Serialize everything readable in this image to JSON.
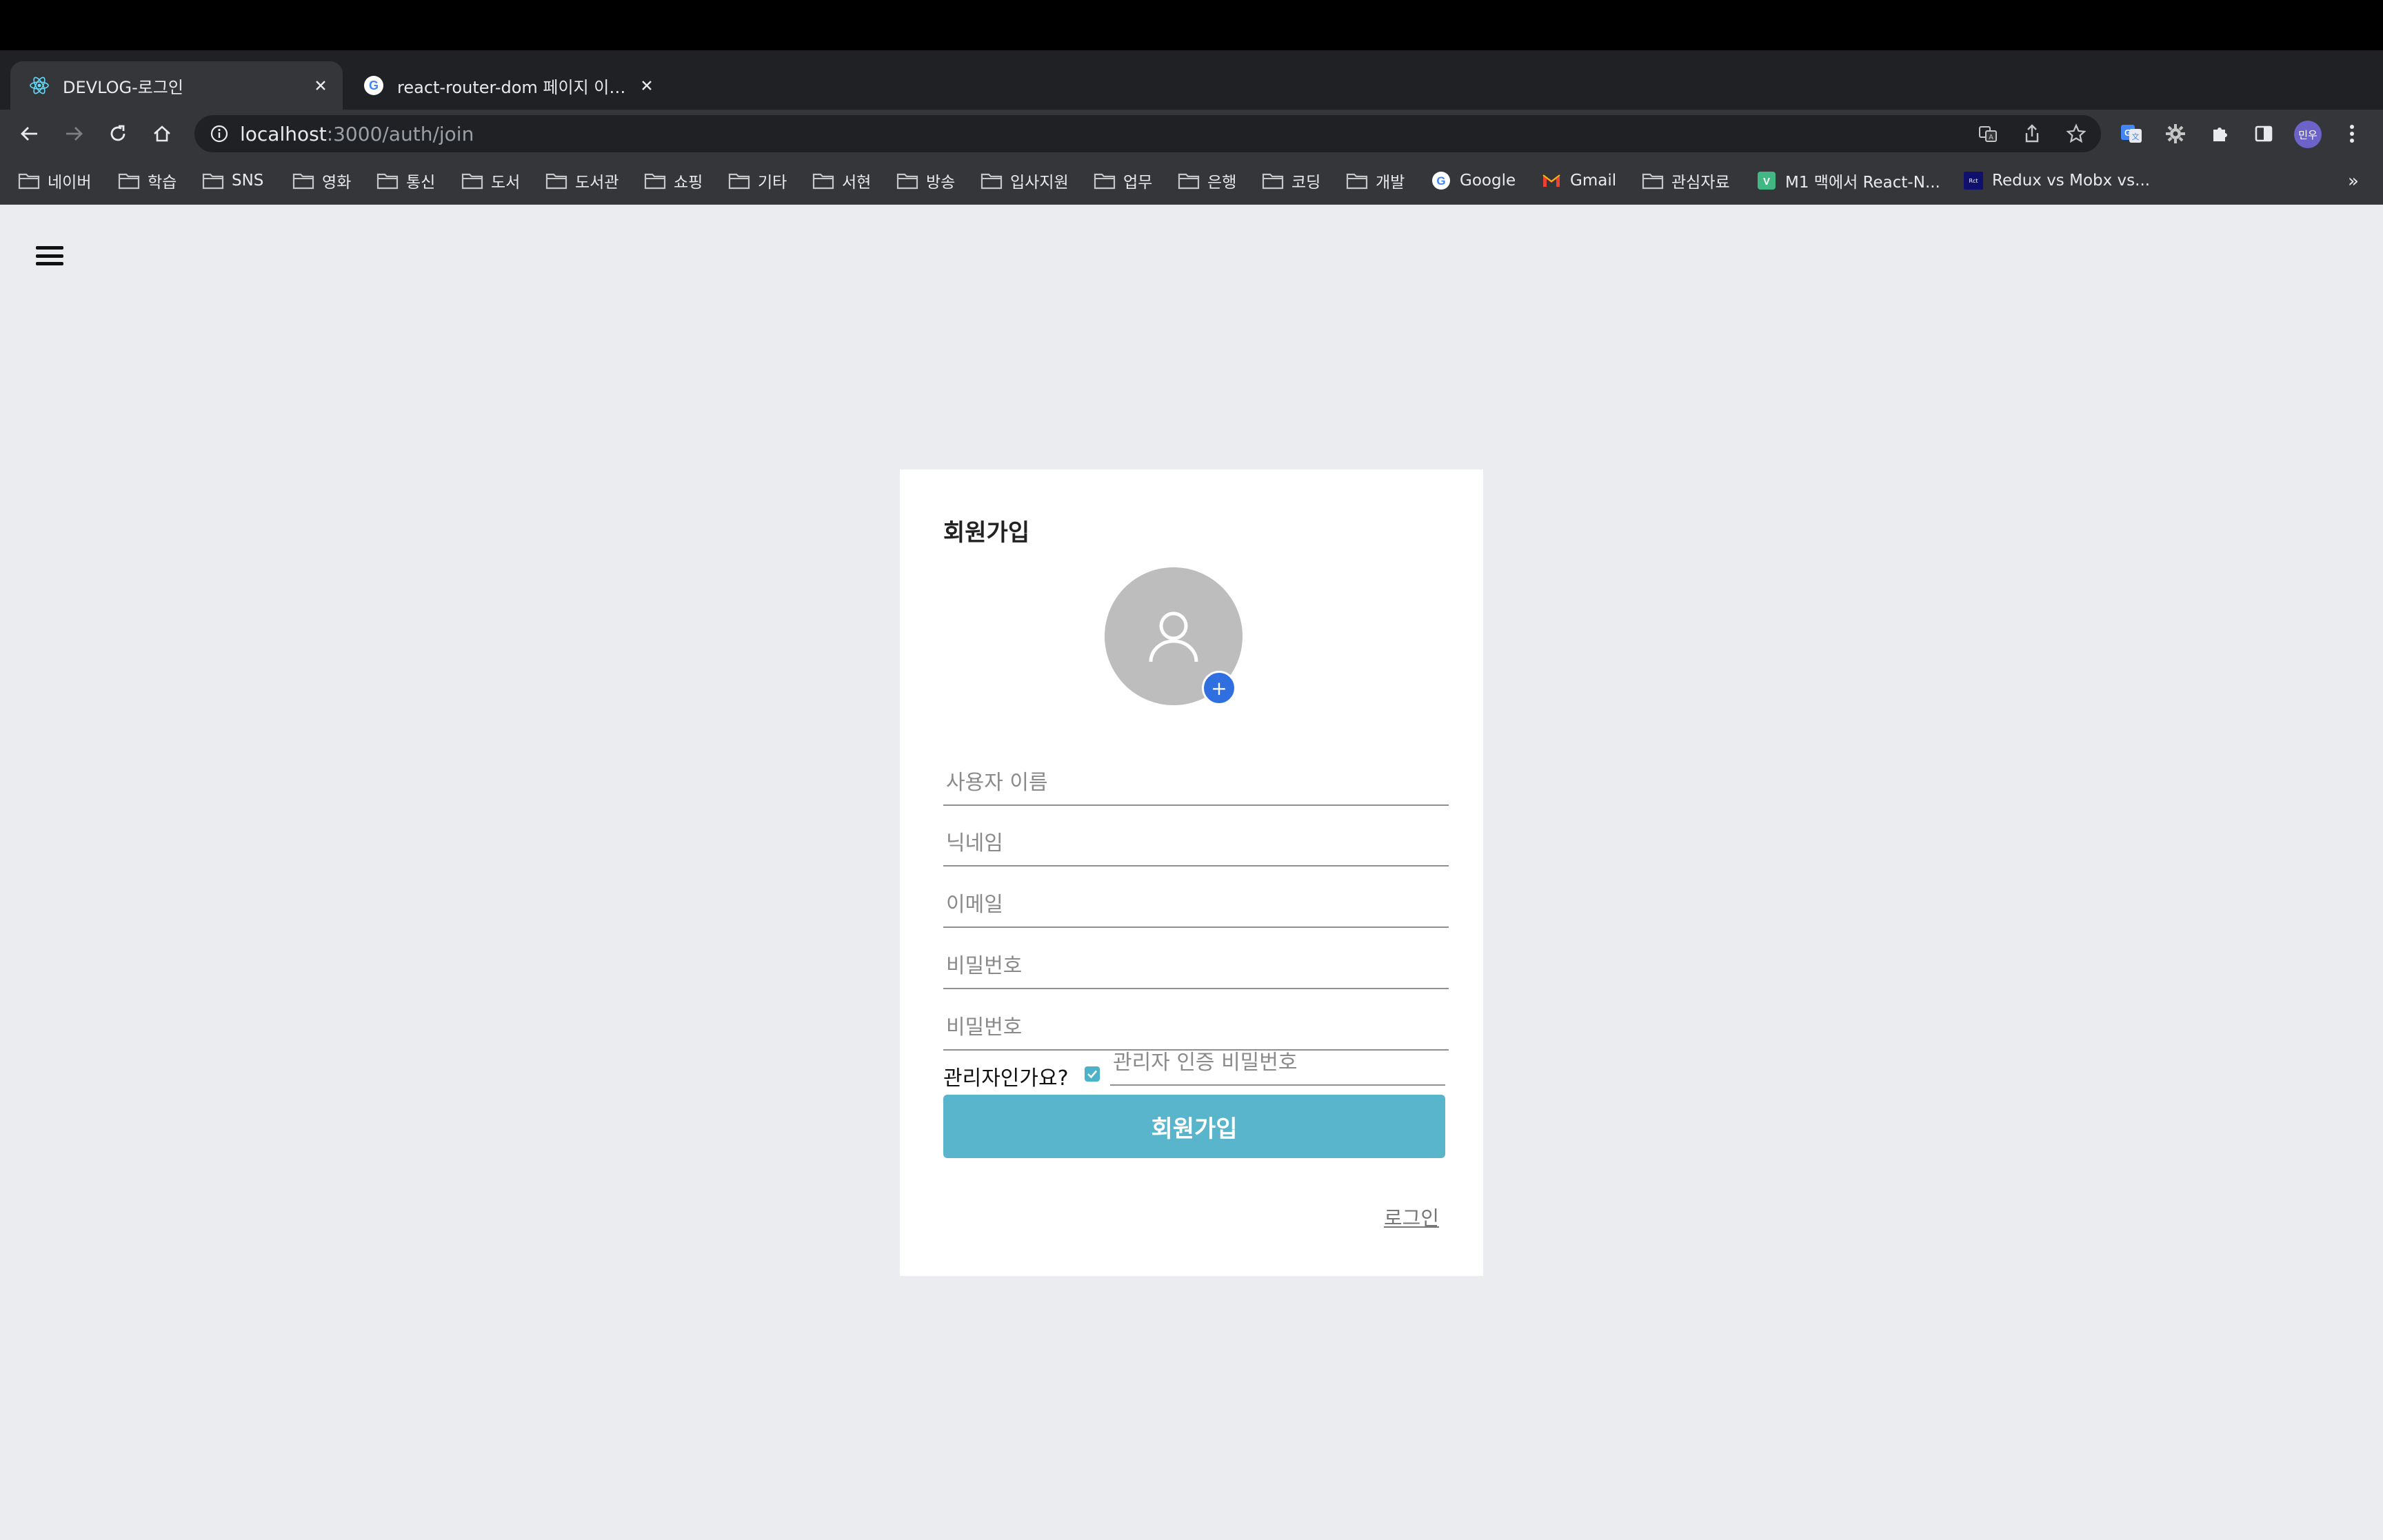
{
  "browser": {
    "tabs": [
      {
        "title": "DEVLOG-로그인",
        "favicon": "react-icon",
        "active": true
      },
      {
        "title": "react-router-dom 페이지 이동 - Google",
        "favicon": "google-icon",
        "active": false
      }
    ],
    "url_host": "localhost",
    "url_path": ":3000/auth/join",
    "profile_label": "민우",
    "bookmarks": [
      {
        "label": "네이버",
        "icon": "folder-icon"
      },
      {
        "label": "학습",
        "icon": "folder-icon"
      },
      {
        "label": "SNS",
        "icon": "folder-icon"
      },
      {
        "label": "영화",
        "icon": "folder-icon"
      },
      {
        "label": "통신",
        "icon": "folder-icon"
      },
      {
        "label": "도서",
        "icon": "folder-icon"
      },
      {
        "label": "도서관",
        "icon": "folder-icon"
      },
      {
        "label": "쇼핑",
        "icon": "folder-icon"
      },
      {
        "label": "기타",
        "icon": "folder-icon"
      },
      {
        "label": "서현",
        "icon": "folder-icon"
      },
      {
        "label": "방송",
        "icon": "folder-icon"
      },
      {
        "label": "입사지원",
        "icon": "folder-icon"
      },
      {
        "label": "업무",
        "icon": "folder-icon"
      },
      {
        "label": "은행",
        "icon": "folder-icon"
      },
      {
        "label": "코딩",
        "icon": "folder-icon"
      },
      {
        "label": "개발",
        "icon": "folder-icon"
      },
      {
        "label": "Google",
        "icon": "google-icon"
      },
      {
        "label": "Gmail",
        "icon": "gmail-icon"
      },
      {
        "label": "관심자료",
        "icon": "folder-icon"
      },
      {
        "label": "M1 맥에서 React-N...",
        "icon": "vue-icon"
      },
      {
        "label": "Redux vs Mobx vs...",
        "icon": "react-site-icon"
      }
    ],
    "bookmarks_overflow": "»"
  },
  "signup": {
    "title": "회원가입",
    "fields": {
      "username_placeholder": "사용자 이름",
      "nickname_placeholder": "닉네임",
      "email_placeholder": "이메일",
      "password_placeholder": "비밀번호",
      "password_confirm_placeholder": "비밀번호"
    },
    "admin_question": "관리자인가요?",
    "admin_checked": true,
    "admin_password_placeholder": "관리자 인증 비밀번호",
    "submit_label": "회원가입",
    "login_link": "로그인",
    "avatar_add_label": "+"
  },
  "colors": {
    "submit": "#59b5cb",
    "avatar_add": "#2f6fe0",
    "page_bg": "#ebecef"
  }
}
